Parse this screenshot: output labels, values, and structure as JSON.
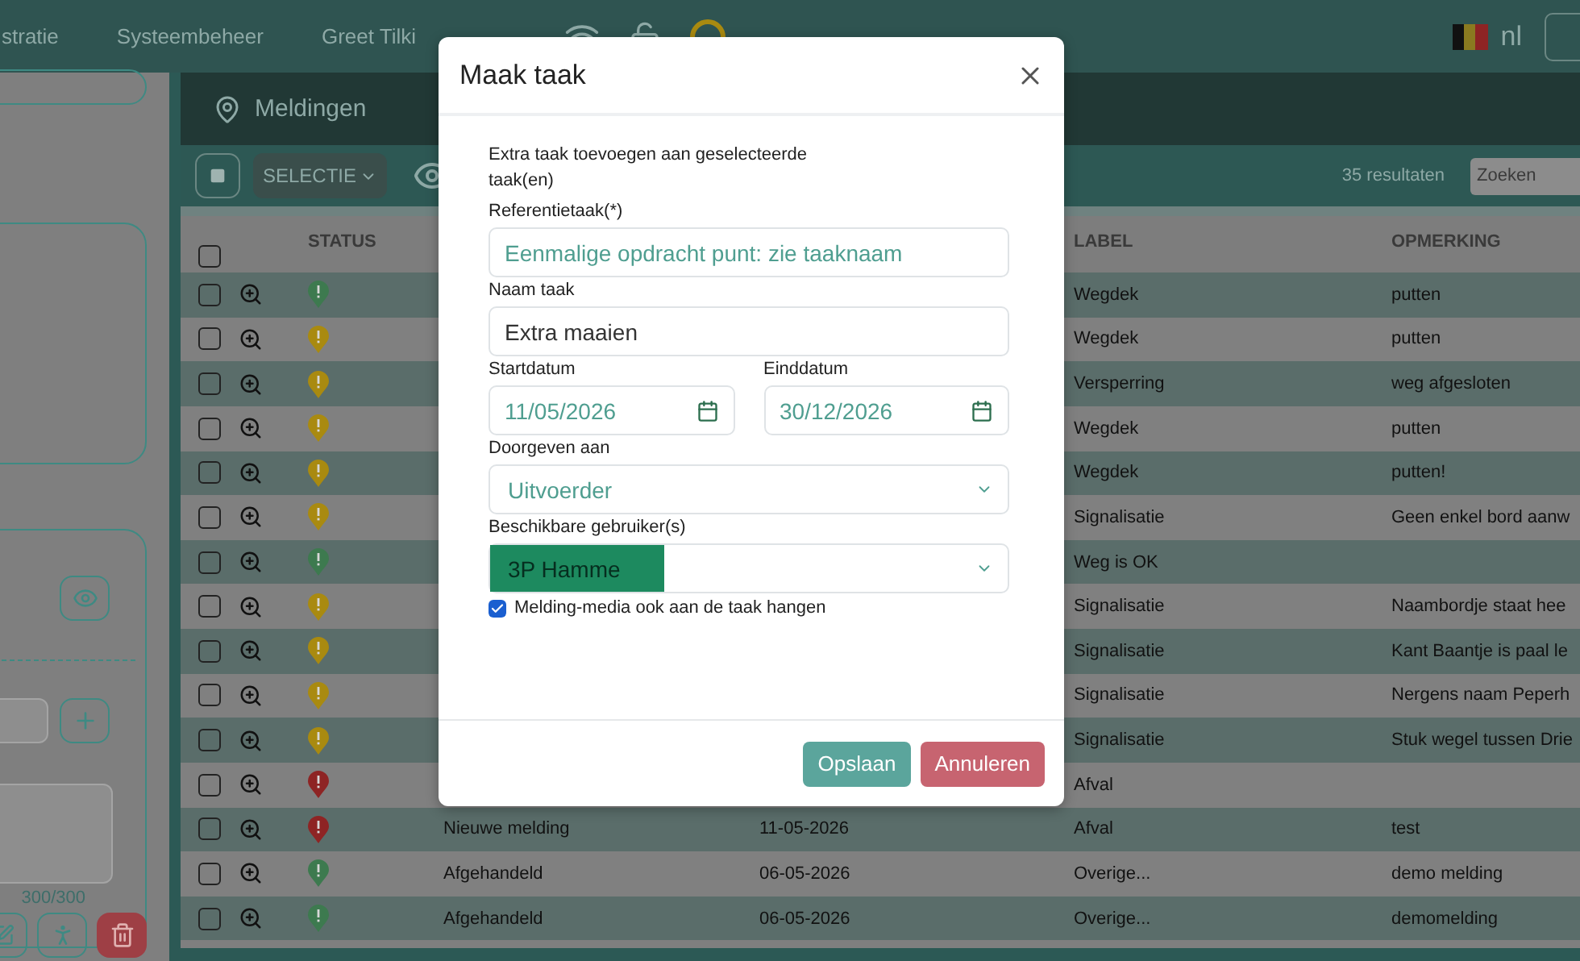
{
  "nav": {
    "items": [
      "stratie",
      "Systeembeheer",
      "Greet Tilki"
    ],
    "language": "nl"
  },
  "left_panel": {
    "counter": "300/300"
  },
  "panel": {
    "title": "Meldingen"
  },
  "toolbar": {
    "selection_button": "SELECTIE",
    "results": "35 resultaten",
    "search_placeholder": "Zoeken"
  },
  "table": {
    "header_checked": false,
    "columns": [
      "STATUS",
      "LABEL",
      "OPMERKING"
    ],
    "rows": [
      {
        "checked": false,
        "color": "#3d7a4f",
        "label": "Wegdek",
        "remark": "putten"
      },
      {
        "checked": false,
        "color": "#a98a10",
        "label": "Wegdek",
        "remark": "putten"
      },
      {
        "checked": false,
        "color": "#a98a10",
        "label": "Versperring",
        "remark": "weg afgesloten"
      },
      {
        "checked": false,
        "color": "#a98a10",
        "label": "Wegdek",
        "remark": "putten"
      },
      {
        "checked": false,
        "color": "#a98a10",
        "label": "Wegdek",
        "remark": "putten!"
      },
      {
        "checked": false,
        "color": "#a98a10",
        "label": "Signalisatie",
        "remark": "Geen enkel bord aanw"
      },
      {
        "checked": false,
        "color": "#3d7a4f",
        "label": "Weg is OK"
      },
      {
        "checked": false,
        "color": "#a98a10",
        "label": "Signalisatie",
        "remark": "Naambordje staat hee"
      },
      {
        "checked": false,
        "color": "#a98a10",
        "label": "Signalisatie",
        "remark": "Kant Baantje is paal le"
      },
      {
        "checked": false,
        "color": "#a98a10",
        "label": "Signalisatie",
        "remark": "Nergens naam Peperh"
      },
      {
        "checked": false,
        "color": "#a98a10",
        "label": "Signalisatie",
        "remark": "Stuk wegel tussen Drie"
      },
      {
        "checked": false,
        "color": "#8e2424",
        "label": "Afval"
      },
      {
        "checked": false,
        "color": "#8e2424",
        "name": "Nieuwe melding",
        "date": "11-05-2026",
        "label": "Afval",
        "remark": "test"
      },
      {
        "checked": false,
        "color": "#3d7a4f",
        "name": "Afgehandeld",
        "date": "06-05-2026",
        "label": "Overige...",
        "remark": "demo melding"
      },
      {
        "checked": false,
        "color": "#3d7a4f",
        "name": "Afgehandeld",
        "date": "06-05-2026",
        "label": "Overige...",
        "remark": "demomelding"
      }
    ]
  },
  "modal": {
    "title": "Maak taak",
    "intro": "Extra taak toevoegen aan geselecteerde taak(en)",
    "reference": {
      "label": "Referentietaak(*)",
      "value": "Eenmalige opdracht punt: zie taaknaam"
    },
    "name": {
      "label": "Naam taak",
      "value": "Extra maaien"
    },
    "start_date": {
      "label": "Startdatum",
      "value": "11/05/2026"
    },
    "end_date": {
      "label": "Einddatum",
      "value": "30/12/2026"
    },
    "forward_to": {
      "label": "Doorgeven aan",
      "value": "Uitvoerder"
    },
    "users": {
      "label": "Beschikbare gebruiker(s)",
      "value": "3P Hamme",
      "highlighted": true
    },
    "media": {
      "label": "Melding-media ook aan de taak hangen",
      "checked": true
    },
    "buttons": [
      {
        "kind": "primary",
        "label": "Opslaan"
      },
      {
        "kind": "danger",
        "label": "Annuleren"
      }
    ]
  }
}
